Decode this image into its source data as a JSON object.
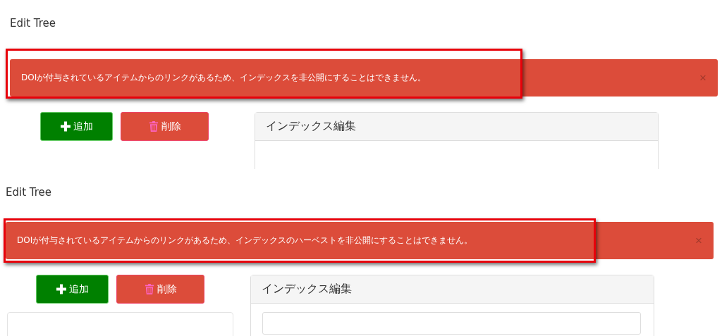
{
  "screens": [
    {
      "title": "Edit Tree",
      "alert": {
        "message": "DOIが付与されているアイテムからのリンクがあるため、インデックスを非公開にすることはできません。",
        "close": "×",
        "highlighted": true
      },
      "buttons": [
        {
          "label": "追加",
          "kind": "add"
        },
        {
          "label": "削除",
          "kind": "delete"
        }
      ],
      "tree_panel": false,
      "panel_title": "インデックス編集"
    },
    {
      "title": "Edit Tree",
      "alert": {
        "message": "DOIが付与されているアイテムからのリンクがあるため、インデックスのハーベストを非公開にすることはできません。",
        "close": "×",
        "highlighted": true
      },
      "buttons": [
        {
          "label": "追加",
          "kind": "add"
        },
        {
          "label": "削除",
          "kind": "delete"
        }
      ],
      "tree_panel": true,
      "panel_title": "インデックス編集"
    }
  ]
}
